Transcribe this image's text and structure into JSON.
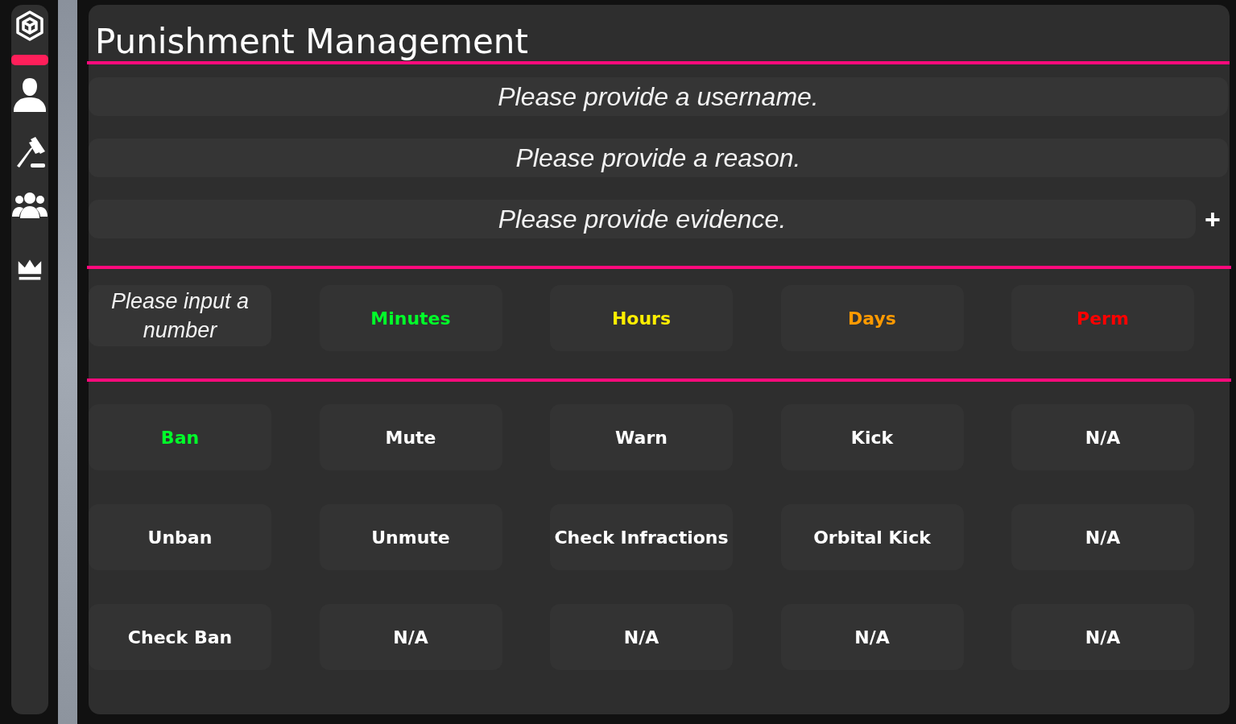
{
  "title": "Punishment Management",
  "fields": [
    {
      "placeholder": "Please provide a username."
    },
    {
      "placeholder": "Please provide a reason."
    },
    {
      "placeholder": "Please provide evidence.",
      "add_button": "+"
    }
  ],
  "duration": {
    "placeholder": "Please input a number",
    "units": [
      {
        "label": "Minutes",
        "color": "#00ff2a"
      },
      {
        "label": "Hours",
        "color": "#ffee00"
      },
      {
        "label": "Days",
        "color": "#ff9a00"
      },
      {
        "label": "Perm",
        "color": "#ff0000"
      }
    ]
  },
  "actions": [
    {
      "label": "Ban",
      "selected": true
    },
    {
      "label": "Mute",
      "selected": false
    },
    {
      "label": "Warn",
      "selected": false
    },
    {
      "label": "Kick",
      "selected": false
    },
    {
      "label": "N/A",
      "selected": false
    },
    {
      "label": "Unban",
      "selected": false
    },
    {
      "label": "Unmute",
      "selected": false
    },
    {
      "label": "Check Infractions",
      "selected": false
    },
    {
      "label": "Orbital Kick",
      "selected": false
    },
    {
      "label": "N/A",
      "selected": false
    },
    {
      "label": "Check Ban",
      "selected": false
    },
    {
      "label": "N/A",
      "selected": false
    },
    {
      "label": "N/A",
      "selected": false
    },
    {
      "label": "N/A",
      "selected": false
    },
    {
      "label": "N/A",
      "selected": false
    }
  ]
}
